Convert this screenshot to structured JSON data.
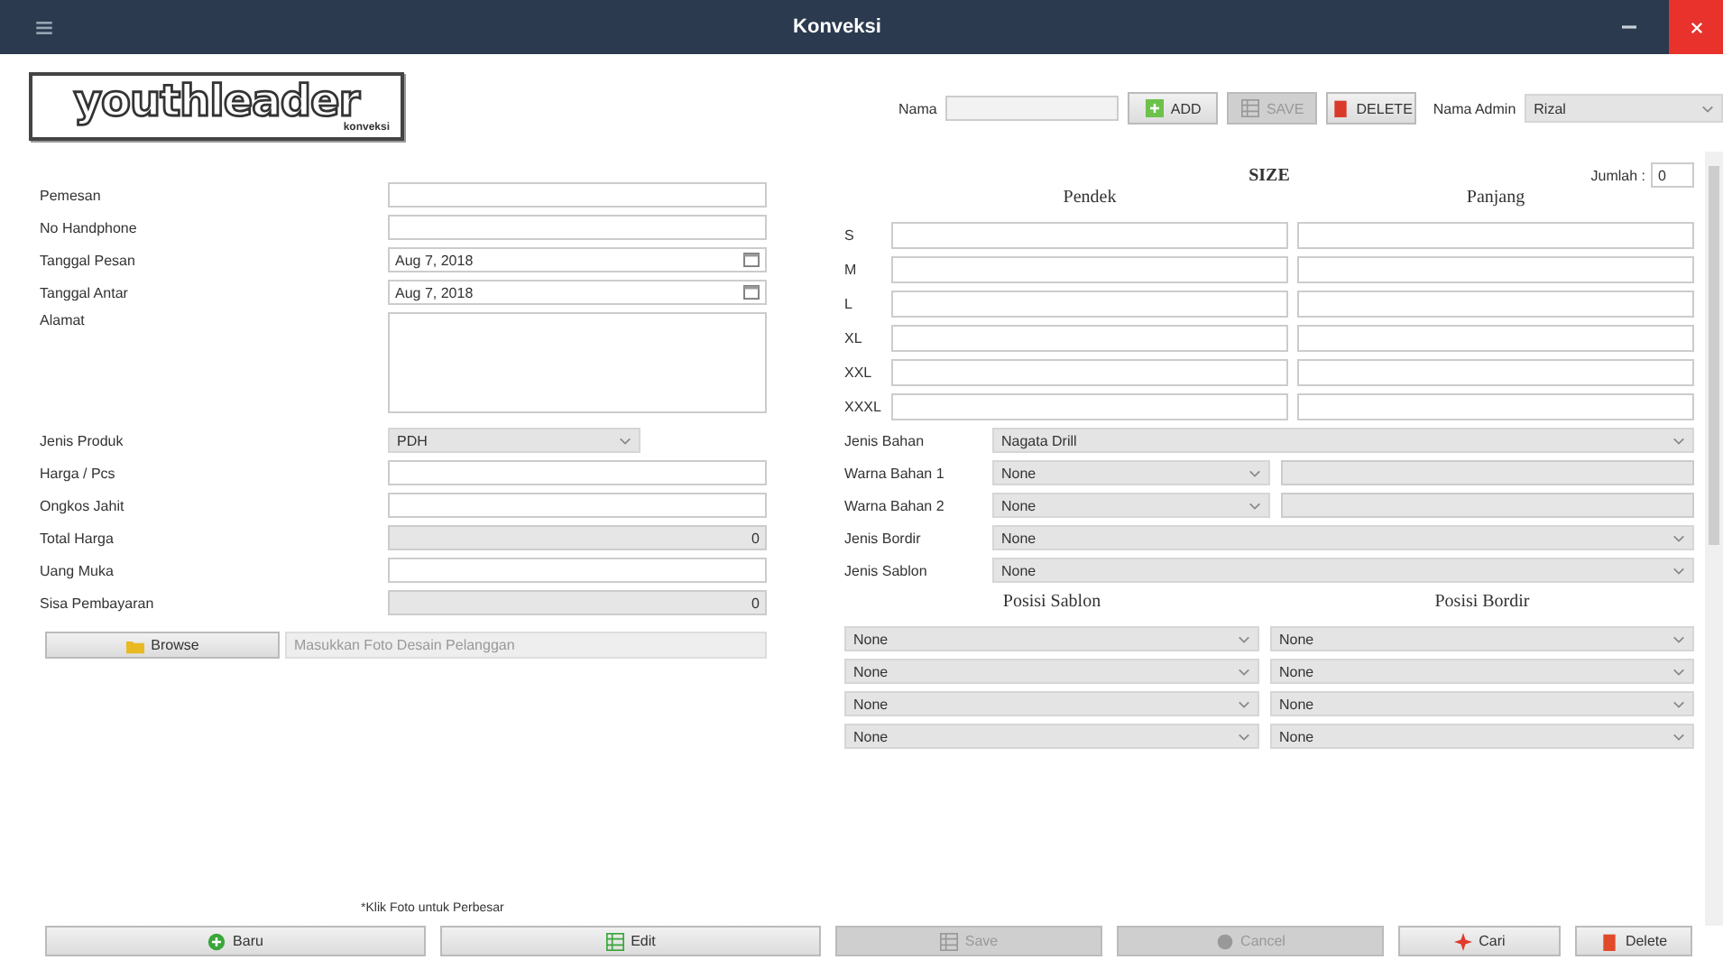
{
  "window": {
    "title": "Konveksi"
  },
  "logo": {
    "text": "youthleader",
    "subtext": "konveksi"
  },
  "toolbar": {
    "name_label": "Nama",
    "buttons": [
      {
        "label": "ADD",
        "kind": "add",
        "disabled": false
      },
      {
        "label": "SAVE",
        "kind": "save",
        "disabled": true
      },
      {
        "label": "DELETE",
        "kind": "delete",
        "disabled": false
      }
    ],
    "admin_label": "Nama Admin",
    "admin_value": "Rizal"
  },
  "order_form": {
    "fields": [
      {
        "label": "Pemesan",
        "kind": "text"
      },
      {
        "label": "No Handphone",
        "kind": "text"
      },
      {
        "label": "Tanggal Pesan",
        "kind": "date",
        "value": "Aug 7, 2018"
      },
      {
        "label": "Tanggal Antar",
        "kind": "date",
        "value": "Aug 7, 2018"
      },
      {
        "label": "Alamat",
        "kind": "textarea"
      },
      {
        "label": "Jenis Produk",
        "kind": "select",
        "value": "PDH"
      },
      {
        "label": "Harga / Pcs",
        "kind": "text"
      },
      {
        "label": "Ongkos Jahit",
        "kind": "text"
      },
      {
        "label": "Total Harga",
        "kind": "readonly",
        "value": "0"
      },
      {
        "label": "Uang Muka",
        "kind": "text"
      },
      {
        "label": "Sisa Pembayaran",
        "kind": "readonly",
        "value": "0"
      }
    ]
  },
  "photo": {
    "browse_label": "Browse",
    "path_placeholder": "Masukkan Foto Desain Pelanggan",
    "note": "*Klik Foto untuk Perbesar"
  },
  "size": {
    "title": "SIZE",
    "count_label": "Jumlah :",
    "count_value": "0",
    "columns": [
      "Pendek",
      "Panjang"
    ],
    "rows": [
      {
        "label": "S"
      },
      {
        "label": "M"
      },
      {
        "label": "L"
      },
      {
        "label": "XL"
      },
      {
        "label": "XXL"
      },
      {
        "label": "XXXL"
      }
    ]
  },
  "material": [
    {
      "label": "Jenis Bahan",
      "kind": "select",
      "value": "Nagata Drill"
    },
    {
      "label": "Warna Bahan 1",
      "kind": "select_text",
      "value": "None"
    },
    {
      "label": "Warna Bahan 2",
      "kind": "select_text",
      "value": "None"
    },
    {
      "label": "Jenis Bordir",
      "kind": "select",
      "value": "None"
    },
    {
      "label": "Jenis Sablon",
      "kind": "select",
      "value": "None"
    }
  ],
  "positions": {
    "headings": [
      "Posisi Sablon",
      "Posisi Bordir"
    ],
    "rows": [
      {
        "sablon": "None",
        "bordir": "None"
      },
      {
        "sablon": "None",
        "bordir": "None"
      },
      {
        "sablon": "None",
        "bordir": "None"
      },
      {
        "sablon": "None",
        "bordir": "None"
      }
    ]
  },
  "actions": [
    {
      "label": "Baru",
      "kind": "new",
      "disabled": false
    },
    {
      "label": "Edit",
      "kind": "edit",
      "disabled": false
    },
    {
      "label": "Save",
      "kind": "save",
      "disabled": true
    },
    {
      "label": "Cancel",
      "kind": "cancel",
      "disabled": true
    },
    {
      "label": "Cari",
      "kind": "find",
      "disabled": false
    },
    {
      "label": "Delete",
      "kind": "delete",
      "disabled": false
    }
  ]
}
